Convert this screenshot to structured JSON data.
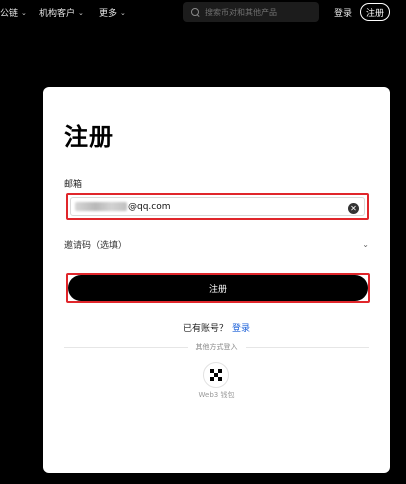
{
  "nav": {
    "items": [
      {
        "label": "公链",
        "icon": "chevron-down-icon"
      },
      {
        "label": "机构客户",
        "icon": "chevron-down-icon"
      },
      {
        "label": "更多",
        "icon": "chevron-down-icon"
      }
    ],
    "search_placeholder": "搜索币对和其他产品",
    "login_label": "登录",
    "signup_label": "注册"
  },
  "form": {
    "title": "注册",
    "email_label": "邮箱",
    "email_value": "@qq.com",
    "invite_label": "邀请码（选填）",
    "submit_label": "注册",
    "have_account_text": "已有账号？",
    "login_link": "登录",
    "other_methods_text": "其他方式登入",
    "web3_label": "Web3 钱包"
  },
  "icons": {
    "search": "search-icon",
    "clear": "clear-circle-icon",
    "invite_toggle": "chevron-down-icon",
    "web3": "web3-wallet-icon"
  },
  "colors": {
    "highlight_border": "#e0262b",
    "link": "#1a5fd8",
    "primary_button": "#000000"
  }
}
